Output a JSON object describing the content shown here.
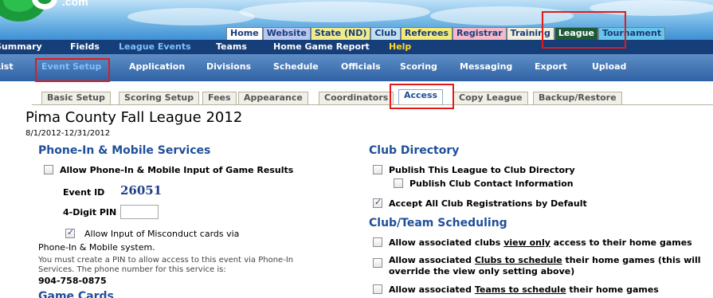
{
  "header": {
    "logo_text": ".com"
  },
  "top_tabs": [
    {
      "label": "Home",
      "bg": "#ffffff"
    },
    {
      "label": "Website",
      "bg": "#b8c7f0"
    },
    {
      "label": "State (ND)",
      "bg": "#f0ec8c"
    },
    {
      "label": "Club",
      "bg": "#bfe0f2"
    },
    {
      "label": "Referees",
      "bg": "#f2ea7a"
    },
    {
      "label": "Registrar",
      "bg": "#f6b9c9"
    },
    {
      "label": "Training",
      "bg": "#f2eedd"
    },
    {
      "label": "League",
      "bg": "#1e5a3a"
    },
    {
      "label": "Tournament",
      "bg": "#67c4ea"
    }
  ],
  "nav1": [
    "Summary",
    "Fields",
    "League Events",
    "Teams",
    "Home Game Report",
    "Help"
  ],
  "nav2": [
    "List",
    "Event Setup",
    "Application",
    "Divisions",
    "Schedule",
    "Officials",
    "Scoring",
    "Messaging",
    "Export",
    "Upload"
  ],
  "subtabs": [
    "Basic Setup",
    "Scoring Setup",
    "Fees",
    "Appearance",
    "Coordinators",
    "Access",
    "Copy League",
    "Backup/Restore"
  ],
  "page": {
    "title": "Pima County Fall League 2012",
    "dates": "8/1/2012-12/31/2012"
  },
  "phone": {
    "heading": "Phone-In & Mobile Services",
    "allow_label": "Allow Phone-In & Mobile Input of Game Results",
    "allow_checked": false,
    "event_id_label": "Event ID",
    "event_id": "26051",
    "pin_label": "4-Digit PIN",
    "pin_value": "",
    "misconduct_line1": "Allow Input of Misconduct cards via",
    "misconduct_line2": "Phone-In & Mobile system.",
    "misconduct_checked": true,
    "note_line1": "You must create a PIN to allow access to this event via Phone-In",
    "note_line2": "Services. The phone number for this service is:",
    "phone_number": "904-758-0875",
    "next_heading_partial": "Game Cards"
  },
  "club_directory": {
    "heading": "Club Directory",
    "publish": "Publish This League to Club Directory",
    "publish_checked": false,
    "contact": "Publish Club Contact Information",
    "contact_checked": false,
    "accept": "Accept All Club Registrations by Default",
    "accept_checked": true
  },
  "scheduling": {
    "heading": "Club/Team Scheduling",
    "opt1_a": "Allow associated clubs ",
    "opt1_u": "view only",
    "opt1_b": " access to their home games",
    "opt2_a": "Allow associated ",
    "opt2_u": "Clubs to schedule",
    "opt2_b": " their home games (this will",
    "opt2_c": "override the view only setting above)",
    "opt3_a": "Allow associated ",
    "opt3_u": "Teams to schedule",
    "opt3_b": " their home games"
  },
  "colors": {
    "accent": "#1f4f9a",
    "nav_dark": "#163e78",
    "highlight": "#e41a1a",
    "nav_active": "#7ec0ff"
  }
}
